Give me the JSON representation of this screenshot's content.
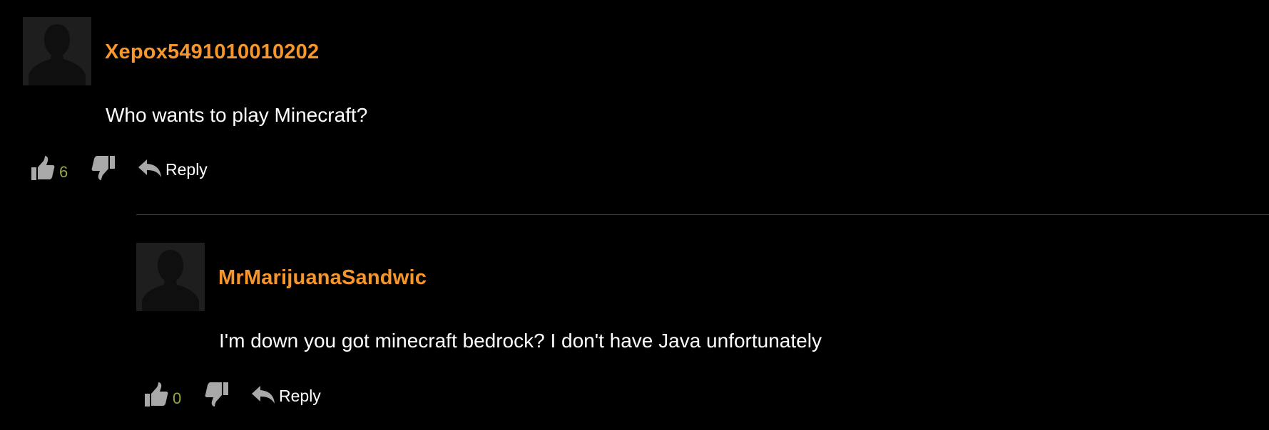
{
  "colors": {
    "background": "#000000",
    "username": "#f7962a",
    "vote_count": "#98a843",
    "icon": "#a8a8a8",
    "divider": "#3a3a3a",
    "avatar_bg": "#1e1e1e"
  },
  "comments": [
    {
      "username": "Xepox5491010010202",
      "text": "Who wants to play Minecraft?",
      "likes": "6",
      "reply_label": "Reply",
      "icons": [
        "avatar-silhouette-icon",
        "thumbs-up-icon",
        "thumbs-down-icon",
        "reply-arrow-icon"
      ]
    },
    {
      "username": "MrMarijuanaSandwic",
      "text": "I'm down you got minecraft bedrock? I don't have Java unfortunately",
      "likes": "0",
      "reply_label": "Reply",
      "icons": [
        "avatar-silhouette-icon",
        "thumbs-up-icon",
        "thumbs-down-icon",
        "reply-arrow-icon"
      ]
    }
  ]
}
